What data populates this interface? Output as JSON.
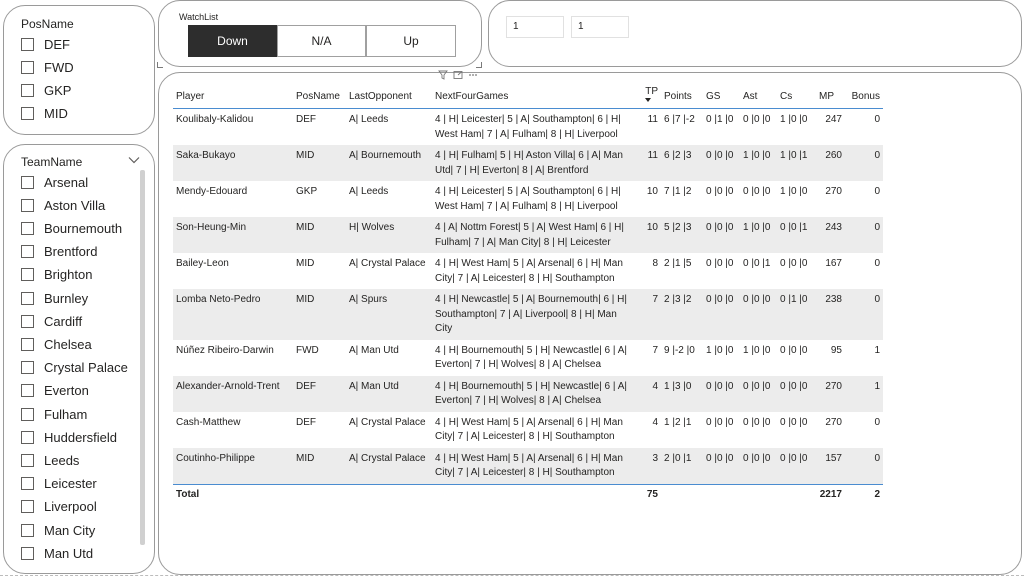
{
  "pos_slicer": {
    "title": "PosName",
    "items": [
      "DEF",
      "FWD",
      "GKP",
      "MID"
    ]
  },
  "team_slicer": {
    "title": "TeamName",
    "items": [
      "Arsenal",
      "Aston Villa",
      "Bournemouth",
      "Brentford",
      "Brighton",
      "Burnley",
      "Cardiff",
      "Chelsea",
      "Crystal Palace",
      "Everton",
      "Fulham",
      "Huddersfield",
      "Leeds",
      "Leicester",
      "Liverpool",
      "Man City",
      "Man Utd"
    ]
  },
  "watchlist": {
    "label": "WatchList",
    "buttons": [
      "Down",
      "N/A",
      "Up"
    ],
    "selected": "Down"
  },
  "inputs": {
    "values": [
      "1",
      "1"
    ]
  },
  "table": {
    "columns": [
      "Player",
      "PosName",
      "LastOpponent",
      "NextFourGames",
      "TP",
      "Points",
      "GS",
      "Ast",
      "Cs",
      "MP",
      "Bonus"
    ],
    "sorted_column": "TP",
    "rows": [
      [
        "Koulibaly-Kalidou",
        "DEF",
        "A| Leeds",
        "4 | H| Leicester| 5 | A| Southampton| 6 | H| West Ham| 7 | A| Fulham| 8 | H| Liverpool",
        "11",
        "6 |7 |-2",
        "0 |1 |0",
        "0 |0 |0",
        "1 |0 |0",
        "247",
        "0"
      ],
      [
        "Saka-Bukayo",
        "MID",
        "A| Bournemouth",
        "4 | H| Fulham| 5 | H| Aston Villa| 6 | A| Man Utd| 7 | H| Everton| 8 | A| Brentford",
        "11",
        "6 |2 |3",
        "0 |0 |0",
        "1 |0 |0",
        "1 |0 |1",
        "260",
        "0"
      ],
      [
        "Mendy-Edouard",
        "GKP",
        "A| Leeds",
        "4 | H| Leicester| 5 | A| Southampton| 6 | H| West Ham| 7 | A| Fulham| 8 | H| Liverpool",
        "10",
        "7 |1 |2",
        "0 |0 |0",
        "0 |0 |0",
        "1 |0 |0",
        "270",
        "0"
      ],
      [
        "Son-Heung-Min",
        "MID",
        "H| Wolves",
        "4 | A| Nottm Forest| 5 | A| West Ham| 6 | H| Fulham| 7 | A| Man City| 8 | H| Leicester",
        "10",
        "5 |2 |3",
        "0 |0 |0",
        "1 |0 |0",
        "0 |0 |1",
        "243",
        "0"
      ],
      [
        "Bailey-Leon",
        "MID",
        "A| Crystal Palace",
        "4 | H| West Ham| 5 | A| Arsenal| 6 | H| Man City| 7 | A| Leicester| 8 | H| Southampton",
        "8",
        "2 |1 |5",
        "0 |0 |0",
        "0 |0 |1",
        "0 |0 |0",
        "167",
        "0"
      ],
      [
        "Lomba Neto-Pedro",
        "MID",
        "A| Spurs",
        "4 | H| Newcastle| 5 | A| Bournemouth| 6 | H| Southampton| 7 | A| Liverpool| 8 | H| Man City",
        "7",
        "2 |3 |2",
        "0 |0 |0",
        "0 |0 |0",
        "0 |1 |0",
        "238",
        "0"
      ],
      [
        "Núñez Ribeiro-Darwin",
        "FWD",
        "A| Man Utd",
        "4 | H| Bournemouth| 5 | H| Newcastle| 6 | A| Everton| 7 | H| Wolves| 8 | A| Chelsea",
        "7",
        "9 |-2 |0",
        "1 |0 |0",
        "1 |0 |0",
        "0 |0 |0",
        "95",
        "1"
      ],
      [
        "Alexander-Arnold-Trent",
        "DEF",
        "A| Man Utd",
        "4 | H| Bournemouth| 5 | H| Newcastle| 6 | A| Everton| 7 | H| Wolves| 8 | A| Chelsea",
        "4",
        "1 |3 |0",
        "0 |0 |0",
        "0 |0 |0",
        "0 |0 |0",
        "270",
        "1"
      ],
      [
        "Cash-Matthew",
        "DEF",
        "A| Crystal Palace",
        "4 | H| West Ham| 5 | A| Arsenal| 6 | H| Man City| 7 | A| Leicester| 8 | H| Southampton",
        "4",
        "1 |2 |1",
        "0 |0 |0",
        "0 |0 |0",
        "0 |0 |0",
        "270",
        "0"
      ],
      [
        "Coutinho-Philippe",
        "MID",
        "A| Crystal Palace",
        "4 | H| West Ham| 5 | A| Arsenal| 6 | H| Man City| 7 | A| Leicester| 8 | H| Southampton",
        "3",
        "2 |0 |1",
        "0 |0 |0",
        "0 |0 |0",
        "0 |0 |0",
        "157",
        "0"
      ]
    ],
    "total": {
      "label": "Total",
      "tp": "75",
      "mp": "2217",
      "bonus": "2"
    }
  }
}
